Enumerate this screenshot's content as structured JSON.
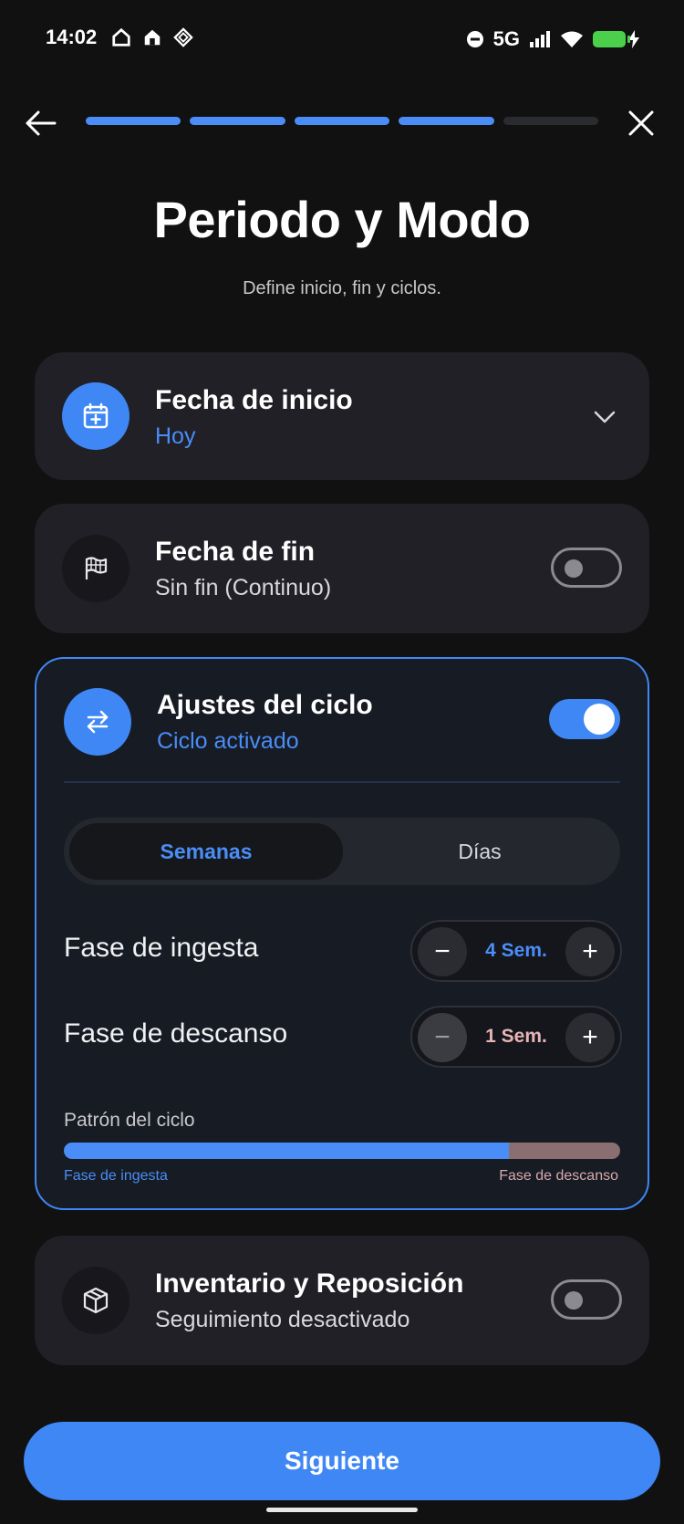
{
  "status": {
    "time": "14:02",
    "network": "5G"
  },
  "header": {
    "progress_steps": 5,
    "progress_completed": 4,
    "title": "Periodo y Modo",
    "subtitle": "Define inicio, fin y ciclos."
  },
  "start_date": {
    "title": "Fecha de inicio",
    "value": "Hoy",
    "icon": "calendar-plus-icon"
  },
  "end_date": {
    "title": "Fecha de fin",
    "value": "Sin fin (Continuo)",
    "icon": "flag-icon",
    "enabled": false
  },
  "cycle": {
    "title": "Ajustes del ciclo",
    "status": "Ciclo activado",
    "icon": "swap-arrows-icon",
    "enabled": true,
    "unit_tabs": [
      "Semanas",
      "Días"
    ],
    "selected_unit": "Semanas",
    "intake_label": "Fase de ingesta",
    "intake_value": "4 Sem.",
    "rest_label": "Fase de descanso",
    "rest_value": "1 Sem.",
    "pattern_label": "Patrón del ciclo",
    "pattern_intake_fraction": 0.8,
    "pattern_legend_intake": "Fase de ingesta",
    "pattern_legend_rest": "Fase de descanso"
  },
  "inventory": {
    "title": "Inventario y Reposición",
    "status": "Seguimiento desactivado",
    "icon": "box-icon",
    "enabled": false
  },
  "footer": {
    "next_label": "Siguiente"
  },
  "colors": {
    "accent": "#3f87f5",
    "background": "#111112",
    "card": "#202026",
    "rest_phase": "#8a6e70"
  }
}
